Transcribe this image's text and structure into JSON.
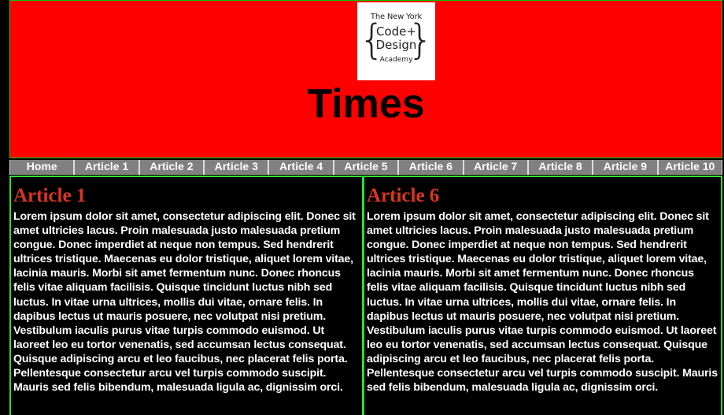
{
  "header": {
    "logo": {
      "line1": "The New York",
      "line2": "Code+",
      "line3": "Design",
      "line4": "Academy",
      "brace_left": "{",
      "brace_right": "}"
    },
    "title": "Times",
    "background": "#ff0000",
    "border": "#00cc00"
  },
  "nav": {
    "items": [
      {
        "label": "Home"
      },
      {
        "label": "Article 1"
      },
      {
        "label": "Article 2"
      },
      {
        "label": "Article 3"
      },
      {
        "label": "Article 4"
      },
      {
        "label": "Article 5"
      },
      {
        "label": "Article 6"
      },
      {
        "label": "Article 7"
      },
      {
        "label": "Article 8"
      },
      {
        "label": "Article 9"
      },
      {
        "label": "Article 10"
      }
    ],
    "background": "#808080"
  },
  "articles": [
    {
      "title": "Article 1",
      "body": "Lorem ipsum dolor sit amet, consectetur adipiscing elit. Donec sit amet ultricies lacus. Proin malesuada justo malesuada pretium congue. Donec imperdiet at neque non tempus. Sed hendrerit ultrices tristique. Maecenas eu dolor tristique, aliquet lorem vitae, lacinia mauris. Morbi sit amet fermentum nunc. Donec rhoncus felis vitae aliquam facilisis. Quisque tincidunt luctus nibh sed luctus. In vitae urna ultrices, mollis dui vitae, ornare felis. In dapibus lectus ut mauris posuere, nec volutpat nisi pretium. Vestibulum iaculis purus vitae turpis commodo euismod. Ut laoreet leo eu tortor venenatis, sed accumsan lectus consequat. Quisque adipiscing arcu et leo faucibus, nec placerat felis porta. Pellentesque consectetur arcu vel turpis commodo suscipit. Mauris sed felis bibendum, malesuada ligula ac, dignissim orci."
    },
    {
      "title": "Article 6",
      "body": "Lorem ipsum dolor sit amet, consectetur adipiscing elit. Donec sit amet ultricies lacus. Proin malesuada justo malesuada pretium congue. Donec imperdiet at neque non tempus. Sed hendrerit ultrices tristique. Maecenas eu dolor tristique, aliquet lorem vitae, lacinia mauris. Morbi sit amet fermentum nunc. Donec rhoncus felis vitae aliquam facilisis. Quisque tincidunt luctus nibh sed luctus. In vitae urna ultrices, mollis dui vitae, ornare felis. In dapibus lectus ut mauris posuere, nec volutpat nisi pretium. Vestibulum iaculis purus vitae turpis commodo euismod. Ut laoreet leo eu tortor venenatis, sed accumsan lectus consequat. Quisque adipiscing arcu et leo faucibus, nec placerat felis porta. Pellentesque consectetur arcu vel turpis commodo suscipit. Mauris sed felis bibendum, malesuada ligula ac, dignissim orci."
    }
  ],
  "colors": {
    "page_background": "#000000",
    "article_heading": "#d9351f",
    "article_text": "#ffffff",
    "article_border": "#33dd33"
  }
}
